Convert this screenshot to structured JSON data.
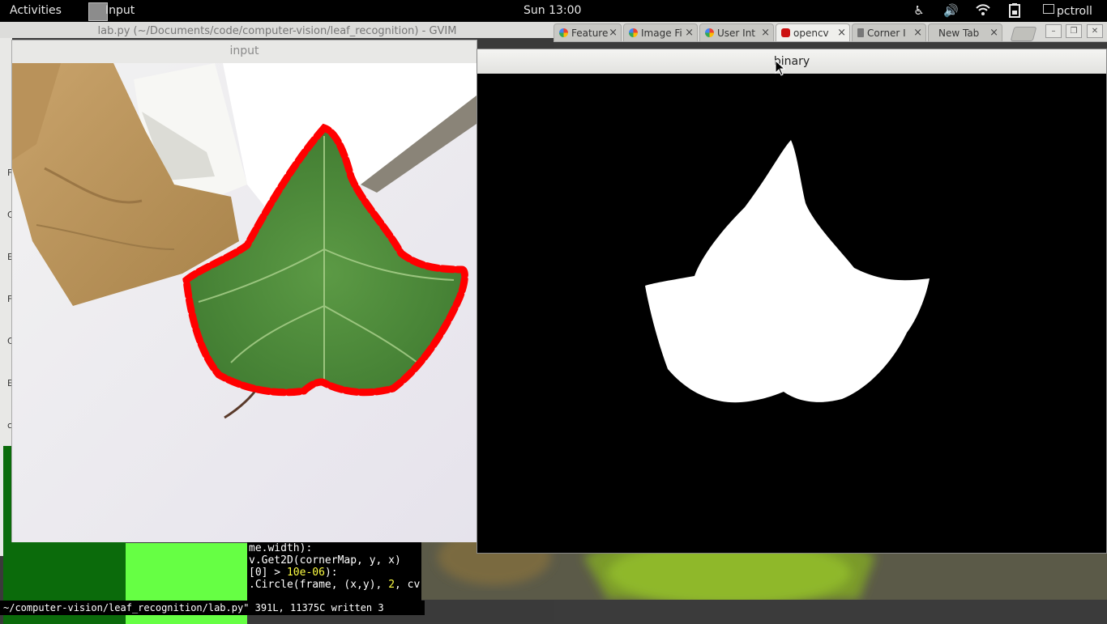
{
  "topbar": {
    "activities": "Activities",
    "app_menu": "Input",
    "clock": "Sun 13:00",
    "user": "pctroll",
    "tray_icons": [
      "accessibility-icon",
      "volume-icon",
      "wifi-icon",
      "battery-icon"
    ]
  },
  "gvim": {
    "title": "lab.py (~/Documents/code/computer-vision/leaf_recognition) - GVIM",
    "left_letters": [
      "F",
      "C",
      "E",
      "F",
      "C",
      "E",
      "c"
    ],
    "code_lines": [
      {
        "before": "me.width):",
        "num": "",
        "after": ""
      },
      {
        "before": "v.Get2D(cornerMap, y, x)",
        "num": "",
        "after": ""
      },
      {
        "before": "[0] > ",
        "num": "10e-06",
        "after": "):"
      },
      {
        "before": ".Circle(frame, (x,y), ",
        "num": "2",
        "after": ", cv"
      }
    ],
    "status": "~/computer-vision/leaf_recognition/lab.py\" 391L, 11375C written 3"
  },
  "browser": {
    "tabs": [
      {
        "label": "Feature",
        "icon": "google-icon"
      },
      {
        "label": "Image Fi",
        "icon": "google-icon"
      },
      {
        "label": "User Int",
        "icon": "google-icon"
      },
      {
        "label": "opencv",
        "icon": "youtube-icon"
      },
      {
        "label": "Corner I",
        "icon": "page-icon"
      },
      {
        "label": "New Tab",
        "icon": ""
      }
    ]
  },
  "windows": {
    "input_title": "input",
    "binary_title": "binary"
  },
  "colors": {
    "contour": "#ff0000",
    "leaf": "#4e8c3a",
    "cardboard": "#c9a36b",
    "gvim_dark_green": "#0b6b0b",
    "gvim_light_green": "#66ff44"
  }
}
